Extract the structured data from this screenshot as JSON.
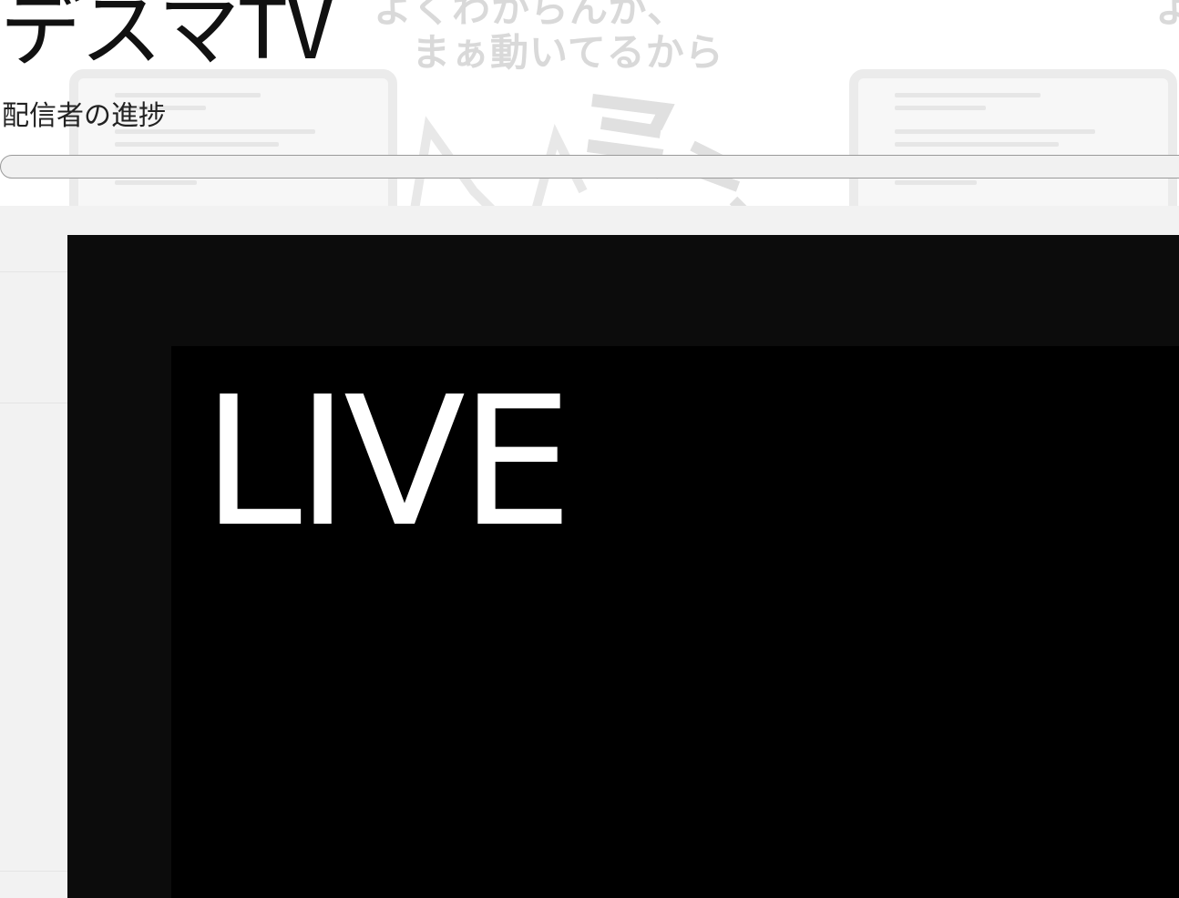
{
  "site": {
    "title": "デスマTV",
    "subtitle": "配信者の進捗"
  },
  "background_art": {
    "caption_line1": "よくわからんが、",
    "caption_line2": "まぁ動いてるから",
    "caption_corner": "よ",
    "icons": [
      "monitor-icon",
      "cat-icon",
      "monitor-icon"
    ]
  },
  "progress": {
    "value_percent": 0,
    "fill_color": "#6fa8dc"
  },
  "player": {
    "overlay_text": "LIVE",
    "background_color": "#000000"
  }
}
